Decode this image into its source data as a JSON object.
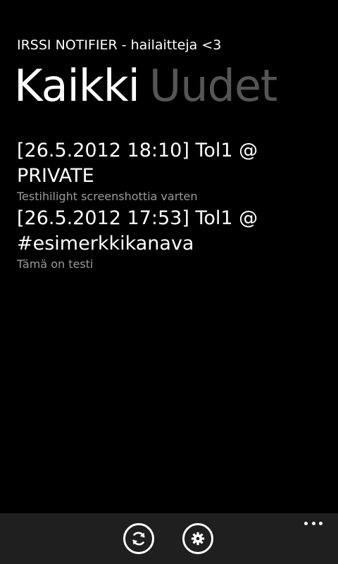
{
  "header": {
    "app_title": "IRSSI NOTIFIER - hailaitteja <3"
  },
  "pivot": {
    "items": [
      {
        "label": "Kaikki",
        "active": true
      },
      {
        "label": "Uudet",
        "active": false
      }
    ]
  },
  "notifications": [
    {
      "title": "[26.5.2012 18:10] Tol1 @ PRIVATE",
      "message": "Testihilight screenshottia varten"
    },
    {
      "title": "[26.5.2012 17:53] Tol1 @ #esimerkkikanava",
      "message": "Tämä on testi"
    }
  ],
  "appbar": {
    "buttons": [
      {
        "icon": "refresh-icon"
      },
      {
        "icon": "gear-icon"
      }
    ],
    "more_icon": "ellipsis-icon"
  }
}
